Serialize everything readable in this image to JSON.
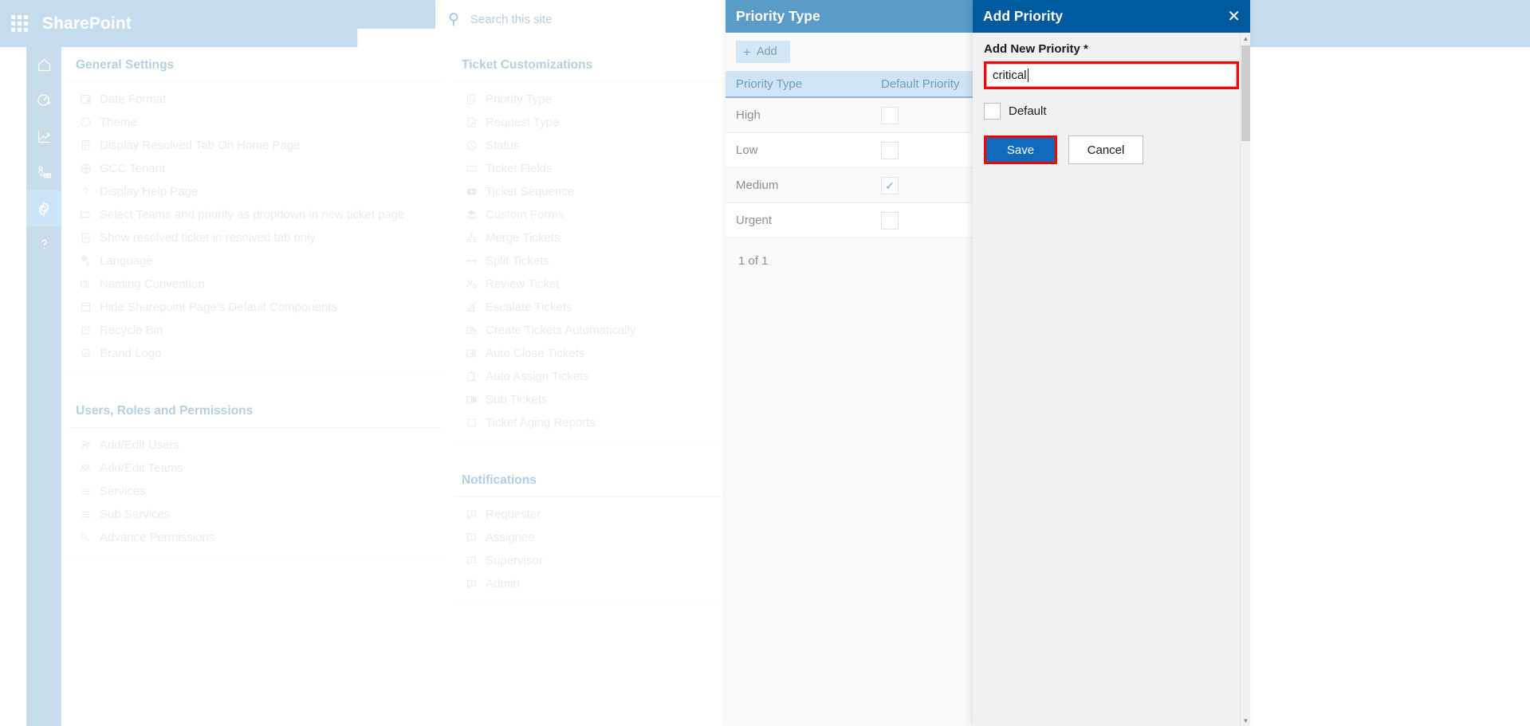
{
  "suite": {
    "app_title": "SharePoint",
    "waffle_icon": "app-launcher-icon",
    "search_icon": "search-icon",
    "search_placeholder": "Search this site",
    "search_value": ""
  },
  "rail": {
    "items": [
      {
        "icon": "home-icon",
        "name": "home"
      },
      {
        "icon": "dashboard-gauge-icon",
        "name": "dashboard"
      },
      {
        "icon": "analytics-chart-icon",
        "name": "analytics"
      },
      {
        "icon": "organization-people-icon",
        "name": "teams"
      },
      {
        "icon": "gear-icon",
        "name": "settings",
        "active": true
      },
      {
        "icon": "question-mark-icon",
        "name": "help"
      }
    ]
  },
  "settings": {
    "columns": [
      {
        "groups": [
          {
            "title": "General Settings",
            "items": [
              {
                "label": "Date Format",
                "icon": "calendar-clock-icon"
              },
              {
                "label": "Theme",
                "icon": "palette-icon"
              },
              {
                "label": "Display Resolved Tab On Home Page",
                "icon": "document-icon"
              },
              {
                "label": "GCC Tenant",
                "icon": "globe-icon"
              },
              {
                "label": "Display Help Page",
                "icon": "question-mark-icon"
              },
              {
                "label": "Select Teams and priority as dropdown in new ticket page",
                "icon": "dropdown-icon"
              },
              {
                "label": "Show resolved ticket in resolved tab only",
                "icon": "document-icon"
              },
              {
                "label": "Language",
                "icon": "translate-icon"
              },
              {
                "label": "Naming Convention",
                "icon": "rename-icon"
              },
              {
                "label": "Hide Sharepoint Page's Default Components",
                "icon": "page-layout-icon"
              },
              {
                "label": "Recycle Bin",
                "icon": "recycle-bin-icon"
              },
              {
                "label": "Brand Logo",
                "icon": "badge-icon"
              }
            ]
          },
          {
            "title": "Users, Roles and Permissions",
            "items": [
              {
                "label": "Add/Edit Users",
                "icon": "people-icon"
              },
              {
                "label": "Add/Edit Teams",
                "icon": "people-team-icon"
              },
              {
                "label": "Services",
                "icon": "list-icon"
              },
              {
                "label": "Sub Services",
                "icon": "sub-list-icon"
              },
              {
                "label": "Advance Permissions",
                "icon": "key-icon"
              }
            ]
          }
        ]
      },
      {
        "groups": [
          {
            "title": "Ticket Customizations",
            "items": [
              {
                "label": "Priority Type",
                "icon": "checklist-icon"
              },
              {
                "label": "Request Type",
                "icon": "edit-document-icon"
              },
              {
                "label": "Status",
                "icon": "clock-icon"
              },
              {
                "label": "Ticket Fields",
                "icon": "ticket-icon"
              },
              {
                "label": "Ticket Sequence",
                "icon": "sequence-icon"
              },
              {
                "label": "Custom Forms",
                "icon": "layers-icon"
              },
              {
                "label": "Merge Tickets",
                "icon": "merge-icon"
              },
              {
                "label": "Split Tickets",
                "icon": "split-arrows-icon"
              },
              {
                "label": "Review Ticket",
                "icon": "person-sync-icon"
              },
              {
                "label": "Escalate Tickets",
                "icon": "chart-up-icon"
              },
              {
                "label": "Create Tickets Automatically",
                "icon": "mail-folder-icon"
              },
              {
                "label": "Auto Close Tickets",
                "icon": "sign-out-icon"
              },
              {
                "label": "Auto Assign Tickets",
                "icon": "clipboard-arrow-icon"
              },
              {
                "label": "Sub Tickets",
                "icon": "panels-icon"
              },
              {
                "label": "Ticket Aging Reports",
                "icon": "square-icon"
              }
            ]
          },
          {
            "title": "Notifications",
            "items": [
              {
                "label": "Requester",
                "icon": "comment-alert-icon"
              },
              {
                "label": "Assignee",
                "icon": "comment-alert-icon"
              },
              {
                "label": "Supervisor",
                "icon": "comment-alert-icon"
              },
              {
                "label": "Admin",
                "icon": "comment-alert-icon"
              }
            ]
          }
        ]
      }
    ]
  },
  "priority_panel": {
    "title": "Priority Type",
    "add_label": "Add",
    "add_icon": "plus-icon",
    "columns": [
      "Priority Type",
      "Default Priority"
    ],
    "rows": [
      {
        "name": "High",
        "default": false
      },
      {
        "name": "Low",
        "default": false
      },
      {
        "name": "Medium",
        "default": true
      },
      {
        "name": "Urgent",
        "default": false
      }
    ],
    "check_icon": "checkmark-icon",
    "pager": "1 of 1"
  },
  "add_priority_panel": {
    "title": "Add Priority",
    "close_icon": "close-icon",
    "field_label": "Add New Priority",
    "required_mark": "*",
    "input_value": "critical",
    "input_placeholder": "",
    "checkbox_label": "Default",
    "checkbox_checked": false,
    "save_label": "Save",
    "cancel_label": "Cancel"
  },
  "colors": {
    "suite_bar": "#c5dcef",
    "mid_header": "#5b9bc8",
    "right_header": "#005a9e",
    "primary_button": "#0f6cbd",
    "highlight_outline": "#ff0000",
    "grid_header": "#cfe4f5"
  },
  "scrollbar": {
    "up_icon": "chevron-up-icon",
    "down_icon": "chevron-down-icon"
  }
}
